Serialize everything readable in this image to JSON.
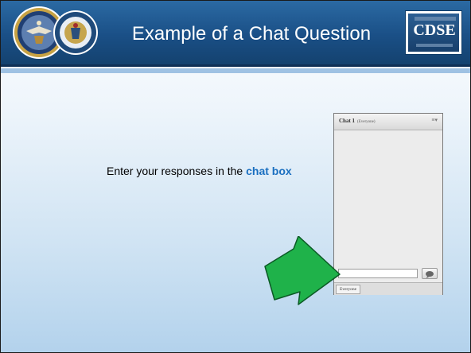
{
  "header": {
    "title": "Example of a Chat Question",
    "logo_text": "CDSE"
  },
  "content": {
    "instruction_text": "Enter your responses in the ",
    "instruction_highlight": "chat box"
  },
  "chat_panel": {
    "title": "Chat 1",
    "audience": "(Everyone)",
    "menu_icon": "menu-icon",
    "send_icon": "speech-bubble-icon",
    "input_value": "",
    "recipient_tab": "Everyone"
  },
  "colors": {
    "header_blue": "#1a4f86",
    "highlight_blue": "#1a6fc0",
    "arrow_green": "#1fb24a",
    "background_light_blue": "#cfe3f3"
  }
}
